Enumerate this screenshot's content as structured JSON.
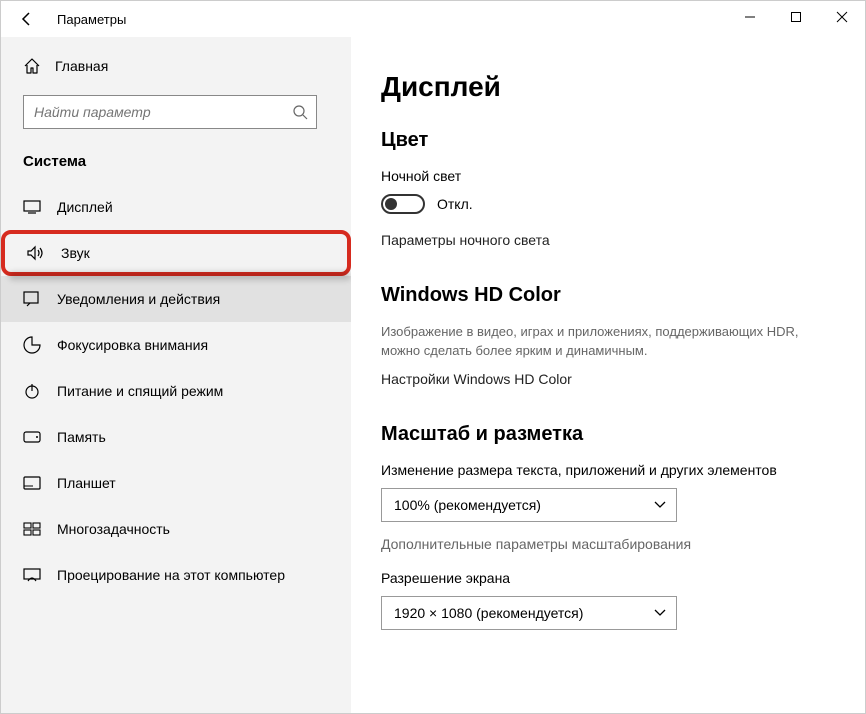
{
  "window": {
    "title": "Параметры"
  },
  "sidebar": {
    "home": "Главная",
    "search_placeholder": "Найти параметр",
    "section": "Система",
    "items": [
      {
        "label": "Дисплей"
      },
      {
        "label": "Звук"
      },
      {
        "label": "Уведомления и действия"
      },
      {
        "label": "Фокусировка внимания"
      },
      {
        "label": "Питание и спящий режим"
      },
      {
        "label": "Память"
      },
      {
        "label": "Планшет"
      },
      {
        "label": "Многозадачность"
      },
      {
        "label": "Проецирование на этот компьютер"
      }
    ]
  },
  "main": {
    "title": "Дисплей",
    "color": {
      "heading": "Цвет",
      "night_light_label": "Ночной свет",
      "toggle_state": "Откл.",
      "night_light_settings": "Параметры ночного света"
    },
    "hdcolor": {
      "heading": "Windows HD Color",
      "desc": "Изображение в видео, играх и приложениях, поддерживающих HDR, можно сделать более ярким и динамичным.",
      "link": "Настройки Windows HD Color"
    },
    "scale": {
      "heading": "Масштаб и разметка",
      "scale_label": "Изменение размера текста, приложений и других элементов",
      "scale_value": "100% (рекомендуется)",
      "advanced": "Дополнительные параметры масштабирования",
      "resolution_label": "Разрешение экрана",
      "resolution_value": "1920 × 1080 (рекомендуется)"
    }
  }
}
